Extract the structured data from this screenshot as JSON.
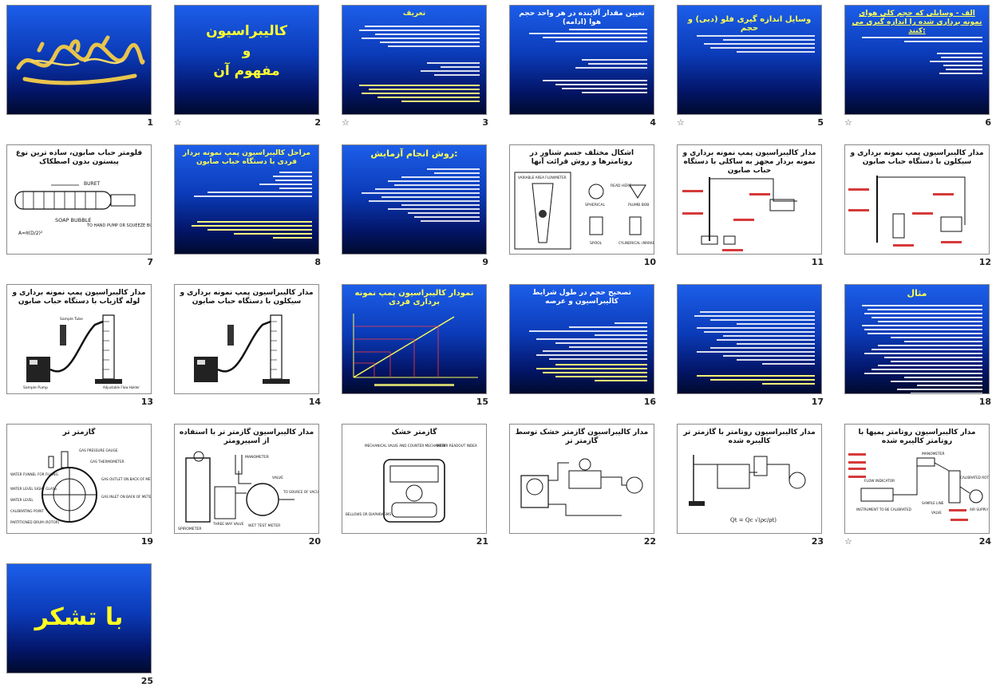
{
  "slides": [
    {
      "n": "1",
      "kind": "blue",
      "title": "",
      "star": false,
      "art": "calligraphy"
    },
    {
      "n": "2",
      "kind": "blue",
      "title": "کالیبراسیون\nو\nمفهوم آن",
      "star": true
    },
    {
      "n": "3",
      "kind": "blue",
      "title": "تعریف",
      "star": true
    },
    {
      "n": "4",
      "kind": "blue",
      "title": "تعیین مقدار آلاینده در هر واحد حجم هوا (ادامه)",
      "star": false
    },
    {
      "n": "5",
      "kind": "blue",
      "title": "وسایل اندازه گیری فلو (دبی) و حجم",
      "star": true
    },
    {
      "n": "6",
      "kind": "blue",
      "title": "الف - وسایلی که حجم کلی هوای نمونه برداری شده را اندازه گیری می کنند:",
      "star": true
    },
    {
      "n": "7",
      "kind": "white",
      "title": "فلومتر حباب صابون، ساده ترین نوع پیستون بدون اصطکاک",
      "star": false,
      "labels": [
        "BURET",
        "SOAP BUBBLE",
        "TO HAND PUMP OR SQUEEZE BULB"
      ]
    },
    {
      "n": "8",
      "kind": "blue",
      "title": "مراحل کالیبراسیون پمپ نمونه بردار فردی با دستگاه حباب صابون",
      "star": false
    },
    {
      "n": "9",
      "kind": "blue",
      "title": "روش انجام آزمایش:",
      "star": false
    },
    {
      "n": "10",
      "kind": "white",
      "title": "اشکال مختلف جسم شناور در روتامترها و روش قرائت آنها",
      "star": false,
      "labels": [
        "VARIABLE AREA FLOWMETER",
        "SPHERICAL",
        "READ HERE",
        "PLUMB BOB",
        "SPOOL",
        "CYLINDRICAL (MARKED)"
      ]
    },
    {
      "n": "11",
      "kind": "white",
      "title": "مدار کالیبراسیون پمپ نمونه برداری و نمونه بردار مجهز به ساکلی با دستگاه حباب صابون",
      "star": false
    },
    {
      "n": "12",
      "kind": "white",
      "title": "مدار کالیبراسیون پمپ نمونه برداری و سیکلون با دستگاه حباب صابون",
      "star": false
    },
    {
      "n": "13",
      "kind": "white",
      "title": "مدار کالیبراسیون پمپ نمونه برداری و لوله گازیاب با دستگاه حباب صابون",
      "star": false,
      "labels": [
        "Sample Tube",
        "Adjustable Flow Holder",
        "Sample Pump"
      ]
    },
    {
      "n": "14",
      "kind": "white",
      "title": "مدار کالیبراسیون پمپ نمونه برداری و سیکلون با دستگاه حباب صابون",
      "star": false
    },
    {
      "n": "15",
      "kind": "blue",
      "title": "نمودار کالیبراسیون پمپ نمونه برداری فردی",
      "star": false
    },
    {
      "n": "16",
      "kind": "blue",
      "title": "تصحیح حجم در طول شرایط کالیبراسیون و عرصه",
      "star": false
    },
    {
      "n": "17",
      "kind": "blue",
      "title": "",
      "star": false
    },
    {
      "n": "18",
      "kind": "blue",
      "title": "مثال",
      "star": false
    },
    {
      "n": "19",
      "kind": "white",
      "title": "گازمتر تر",
      "star": false,
      "labels": [
        "GAS PRESSURE GAUGE",
        "GAS THERMOMETER",
        "WATER FUNNEL FOR FILLING",
        "GAS OUTLET ON BACK OF METER",
        "WATER LEVEL SIGHT GLASS",
        "WATER LEVEL",
        "GAS INLET ON BACK OF METER",
        "CALIBRATING POINT",
        "PARTITIONED DRUM (ROTOR)"
      ]
    },
    {
      "n": "20",
      "kind": "white",
      "title": "مدار کالیبراسیون گازمتر تر با استفاده از اسپیرومتر",
      "star": false,
      "labels": [
        "MANOMETER",
        "VALVE",
        "THREE WAY VALVE",
        "TO SOURCE OF VACUUM",
        "SPIROMETER",
        "WET TEST METER"
      ]
    },
    {
      "n": "21",
      "kind": "white",
      "title": "گازمتر خشک",
      "star": false,
      "labels": [
        "MECHANICAL VALVE AND COUNTER MECHANISM",
        "METER READOUT INDEX",
        "BELLOWS OR DIAPHRAGMS"
      ]
    },
    {
      "n": "22",
      "kind": "white",
      "title": "مدار کالیبراسیون گازمتر خشک توسط گازمتر تر",
      "star": false
    },
    {
      "n": "23",
      "kind": "white",
      "title": "مدار کالیبراسیون روتامتر با گازمتر تر کالیبره شده",
      "star": false
    },
    {
      "n": "24",
      "kind": "white",
      "title": "مدار کالیبراسیون روتامتر پمپها با روتامتر کالیبره شده",
      "star": true,
      "labels": [
        "FLOW INDICATOR",
        "MANOMETER",
        "CALIBRATED ROTAMETER",
        "INSTRUMENT TO BE CALIBRATED",
        "SAMPLE LINE",
        "VALVE",
        "AIR SUPPLY"
      ]
    },
    {
      "n": "25",
      "kind": "blue",
      "title": "با تشکر",
      "star": false
    }
  ]
}
